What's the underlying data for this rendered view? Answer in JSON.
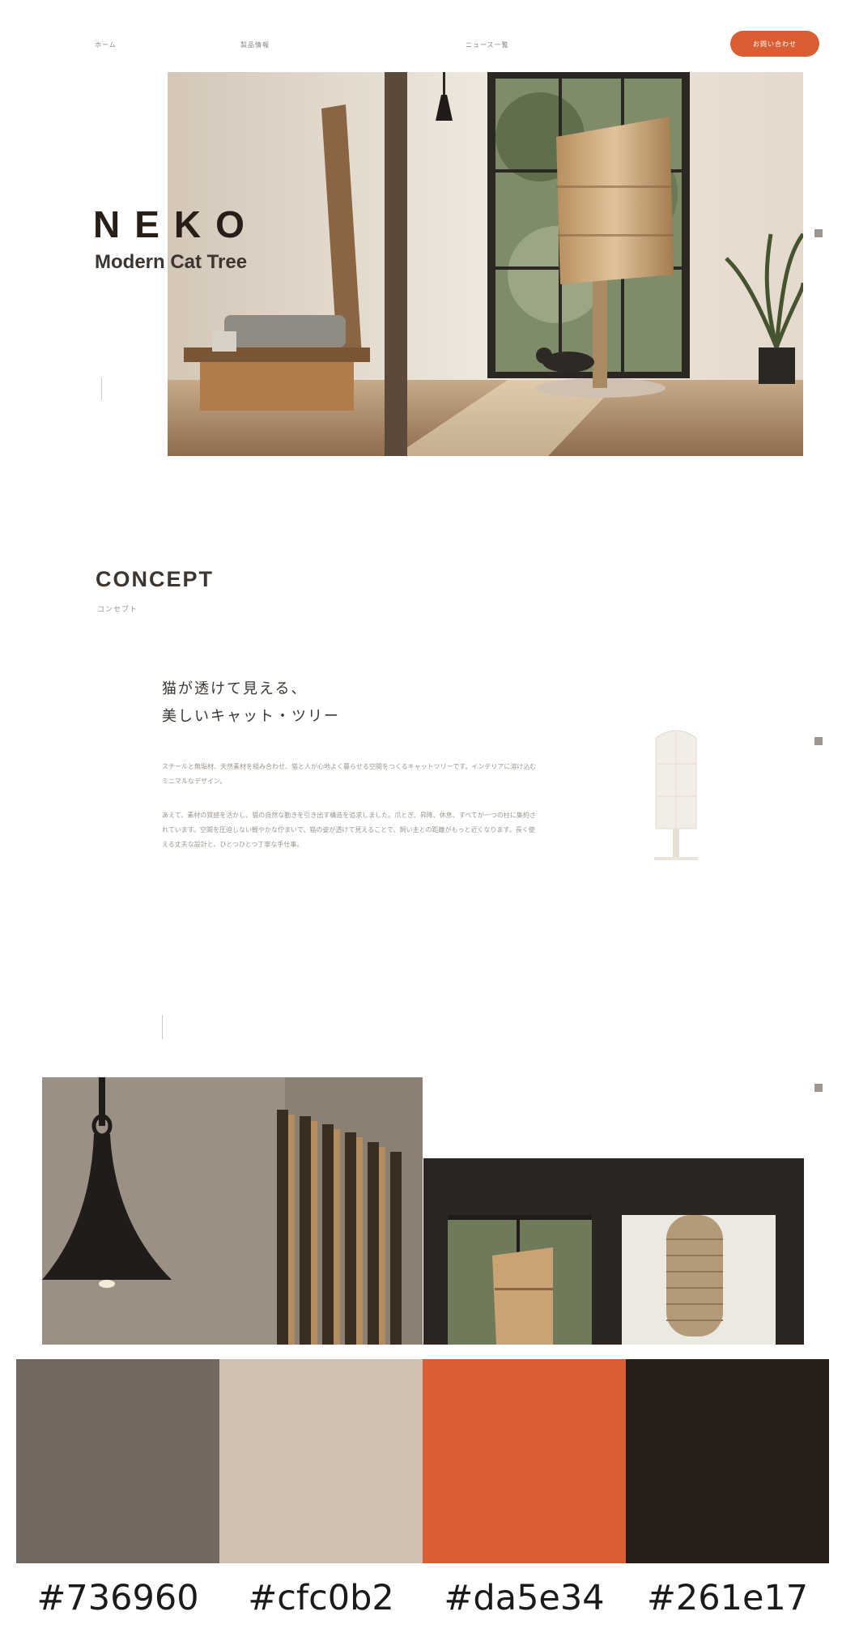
{
  "header": {
    "nav": [
      "ホーム",
      "製品情報",
      "ニュース一覧"
    ],
    "cta_label": "お問い合わせ"
  },
  "hero": {
    "brand": "NEKO",
    "tagline": "Modern Cat Tree"
  },
  "concept": {
    "title": "CONCEPT",
    "subtitle": "コンセプト",
    "headline_line1": "猫が透けて見える、",
    "headline_line2": "美しいキャット・ツリー",
    "para1": "スチールと無垢材、天然素材を組み合わせ、猫と人が心地よく暮らせる空間をつくるキャットツリーです。インテリアに溶け込むミニマルなデザイン。",
    "para2": "あえて、素材の質感を活かし、猫の自然な動きを引き出す構造を追求しました。爪とぎ、昇降、休息、すべてが一つの柱に集約されています。空間を圧迫しない軽やかな佇まいで、猫の姿が透けて見えることで、飼い主との距離がもっと近くなります。長く使える丈夫な設計と、ひとつひとつ丁寧な手仕事。"
  },
  "palette": {
    "colors": [
      "#736960",
      "#cfc0b2",
      "#da5e34",
      "#261e17"
    ],
    "labels": [
      "#736960",
      "#cfc0b2",
      "#da5e34",
      "#261e17"
    ]
  }
}
